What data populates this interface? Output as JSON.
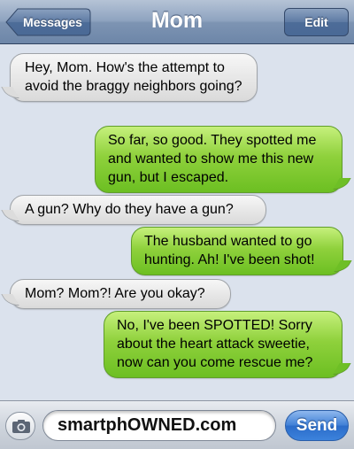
{
  "navbar": {
    "back_label": "Messages",
    "title": "Mom",
    "edit_label": "Edit"
  },
  "messages": [
    {
      "from": "them",
      "text": "Hey, Mom. How's the attempt to avoid the braggy neighbors going?"
    },
    {
      "from": "me",
      "text": "So far, so good. They spotted me and wanted to show me this new gun, but I escaped."
    },
    {
      "from": "them",
      "text": "A gun? Why do they have a gun?"
    },
    {
      "from": "me",
      "text": "The husband wanted to go hunting. Ah! I've been shot!"
    },
    {
      "from": "them",
      "text": "Mom? Mom?! Are you okay?"
    },
    {
      "from": "me",
      "text": "No, I've been SPOTTED! Sorry about the heart attack sweetie, now can you come rescue me?"
    }
  ],
  "input": {
    "value": "smartphOWNED.com",
    "send_label": "Send"
  },
  "icons": {
    "camera": "camera-icon",
    "back": "back-arrow-button"
  },
  "colors": {
    "outgoing_bubble": "#7fcb30",
    "incoming_bubble": "#e6e6e6",
    "navbar": "#8ea3bf",
    "send_button": "#3f7fd6"
  }
}
